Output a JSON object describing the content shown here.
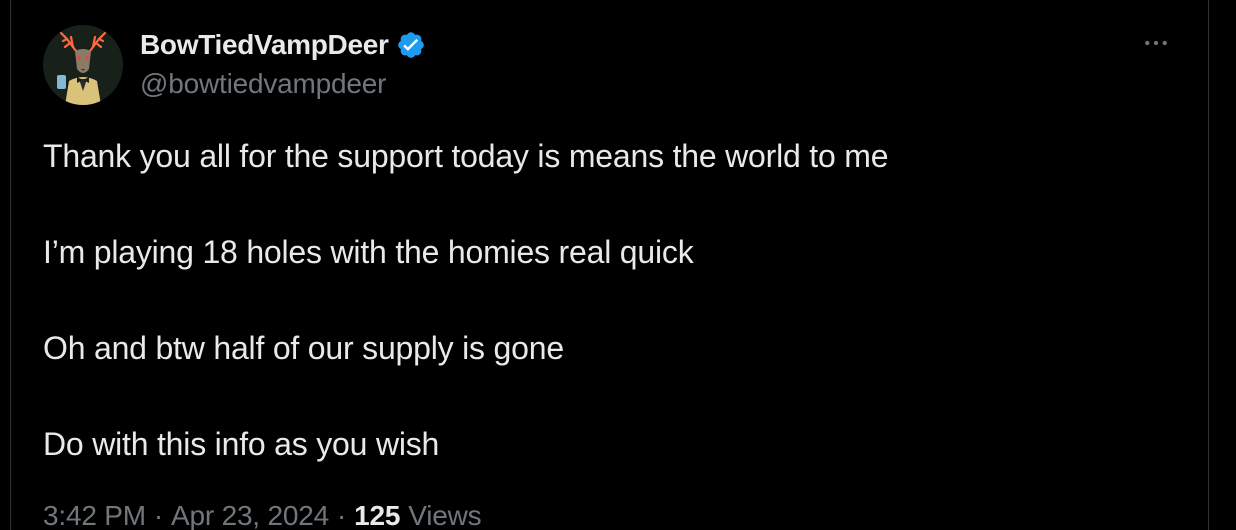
{
  "author": {
    "display_name": "BowTiedVampDeer",
    "handle": "@bowtiedvampdeer",
    "verified": true,
    "avatar_icon": "deer-avatar-icon",
    "verified_icon": "verified-badge-icon",
    "verified_color": "#1d9bf0"
  },
  "menu": {
    "more_icon": "more-horizontal-icon"
  },
  "tweet": {
    "lines": [
      "Thank you all for the support today is means the world to me",
      "I’m playing 18 holes with the homies real quick",
      "Oh and btw half of our supply is gone",
      "Do with this info as you wish"
    ]
  },
  "meta": {
    "time": "3:42 PM",
    "separator": "·",
    "date": "Apr 23, 2024",
    "views_count": "125",
    "views_label": "Views"
  },
  "colors": {
    "background": "#000000",
    "text": "#e7e9ea",
    "secondary_text": "#71767b",
    "border": "#2f3336"
  }
}
